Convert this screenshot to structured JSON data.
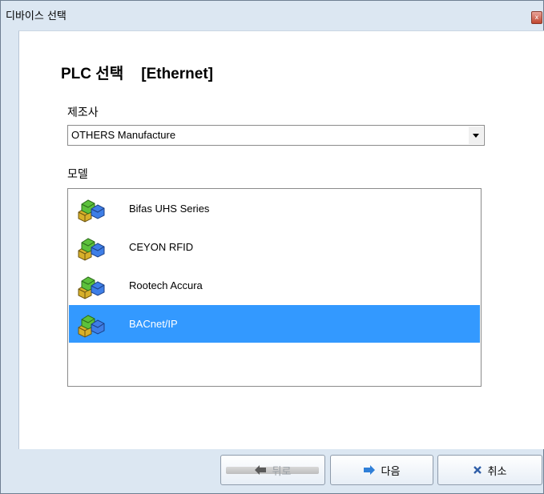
{
  "window": {
    "title": "디바이스 선택",
    "close_glyph": "x"
  },
  "heading": {
    "title": "PLC 선택",
    "subtitle": "[Ethernet]"
  },
  "manufacturer": {
    "label": "제조사",
    "value": "OTHERS Manufacture"
  },
  "model": {
    "label": "모델",
    "items": [
      {
        "label": "Bifas UHS Series",
        "icon": "plc-device-icon",
        "selected": false
      },
      {
        "label": "CEYON RFID",
        "icon": "plc-device-icon",
        "selected": false
      },
      {
        "label": "Rootech Accura",
        "icon": "plc-device-icon",
        "selected": false
      },
      {
        "label": "BACnet/IP",
        "icon": "plc-device-icon",
        "selected": true
      }
    ]
  },
  "footer": {
    "back_label": "뒤로",
    "next_label": "다음",
    "cancel_label": "취소"
  },
  "colors": {
    "selection": "#3399ff",
    "frame": "#dce7f2"
  }
}
